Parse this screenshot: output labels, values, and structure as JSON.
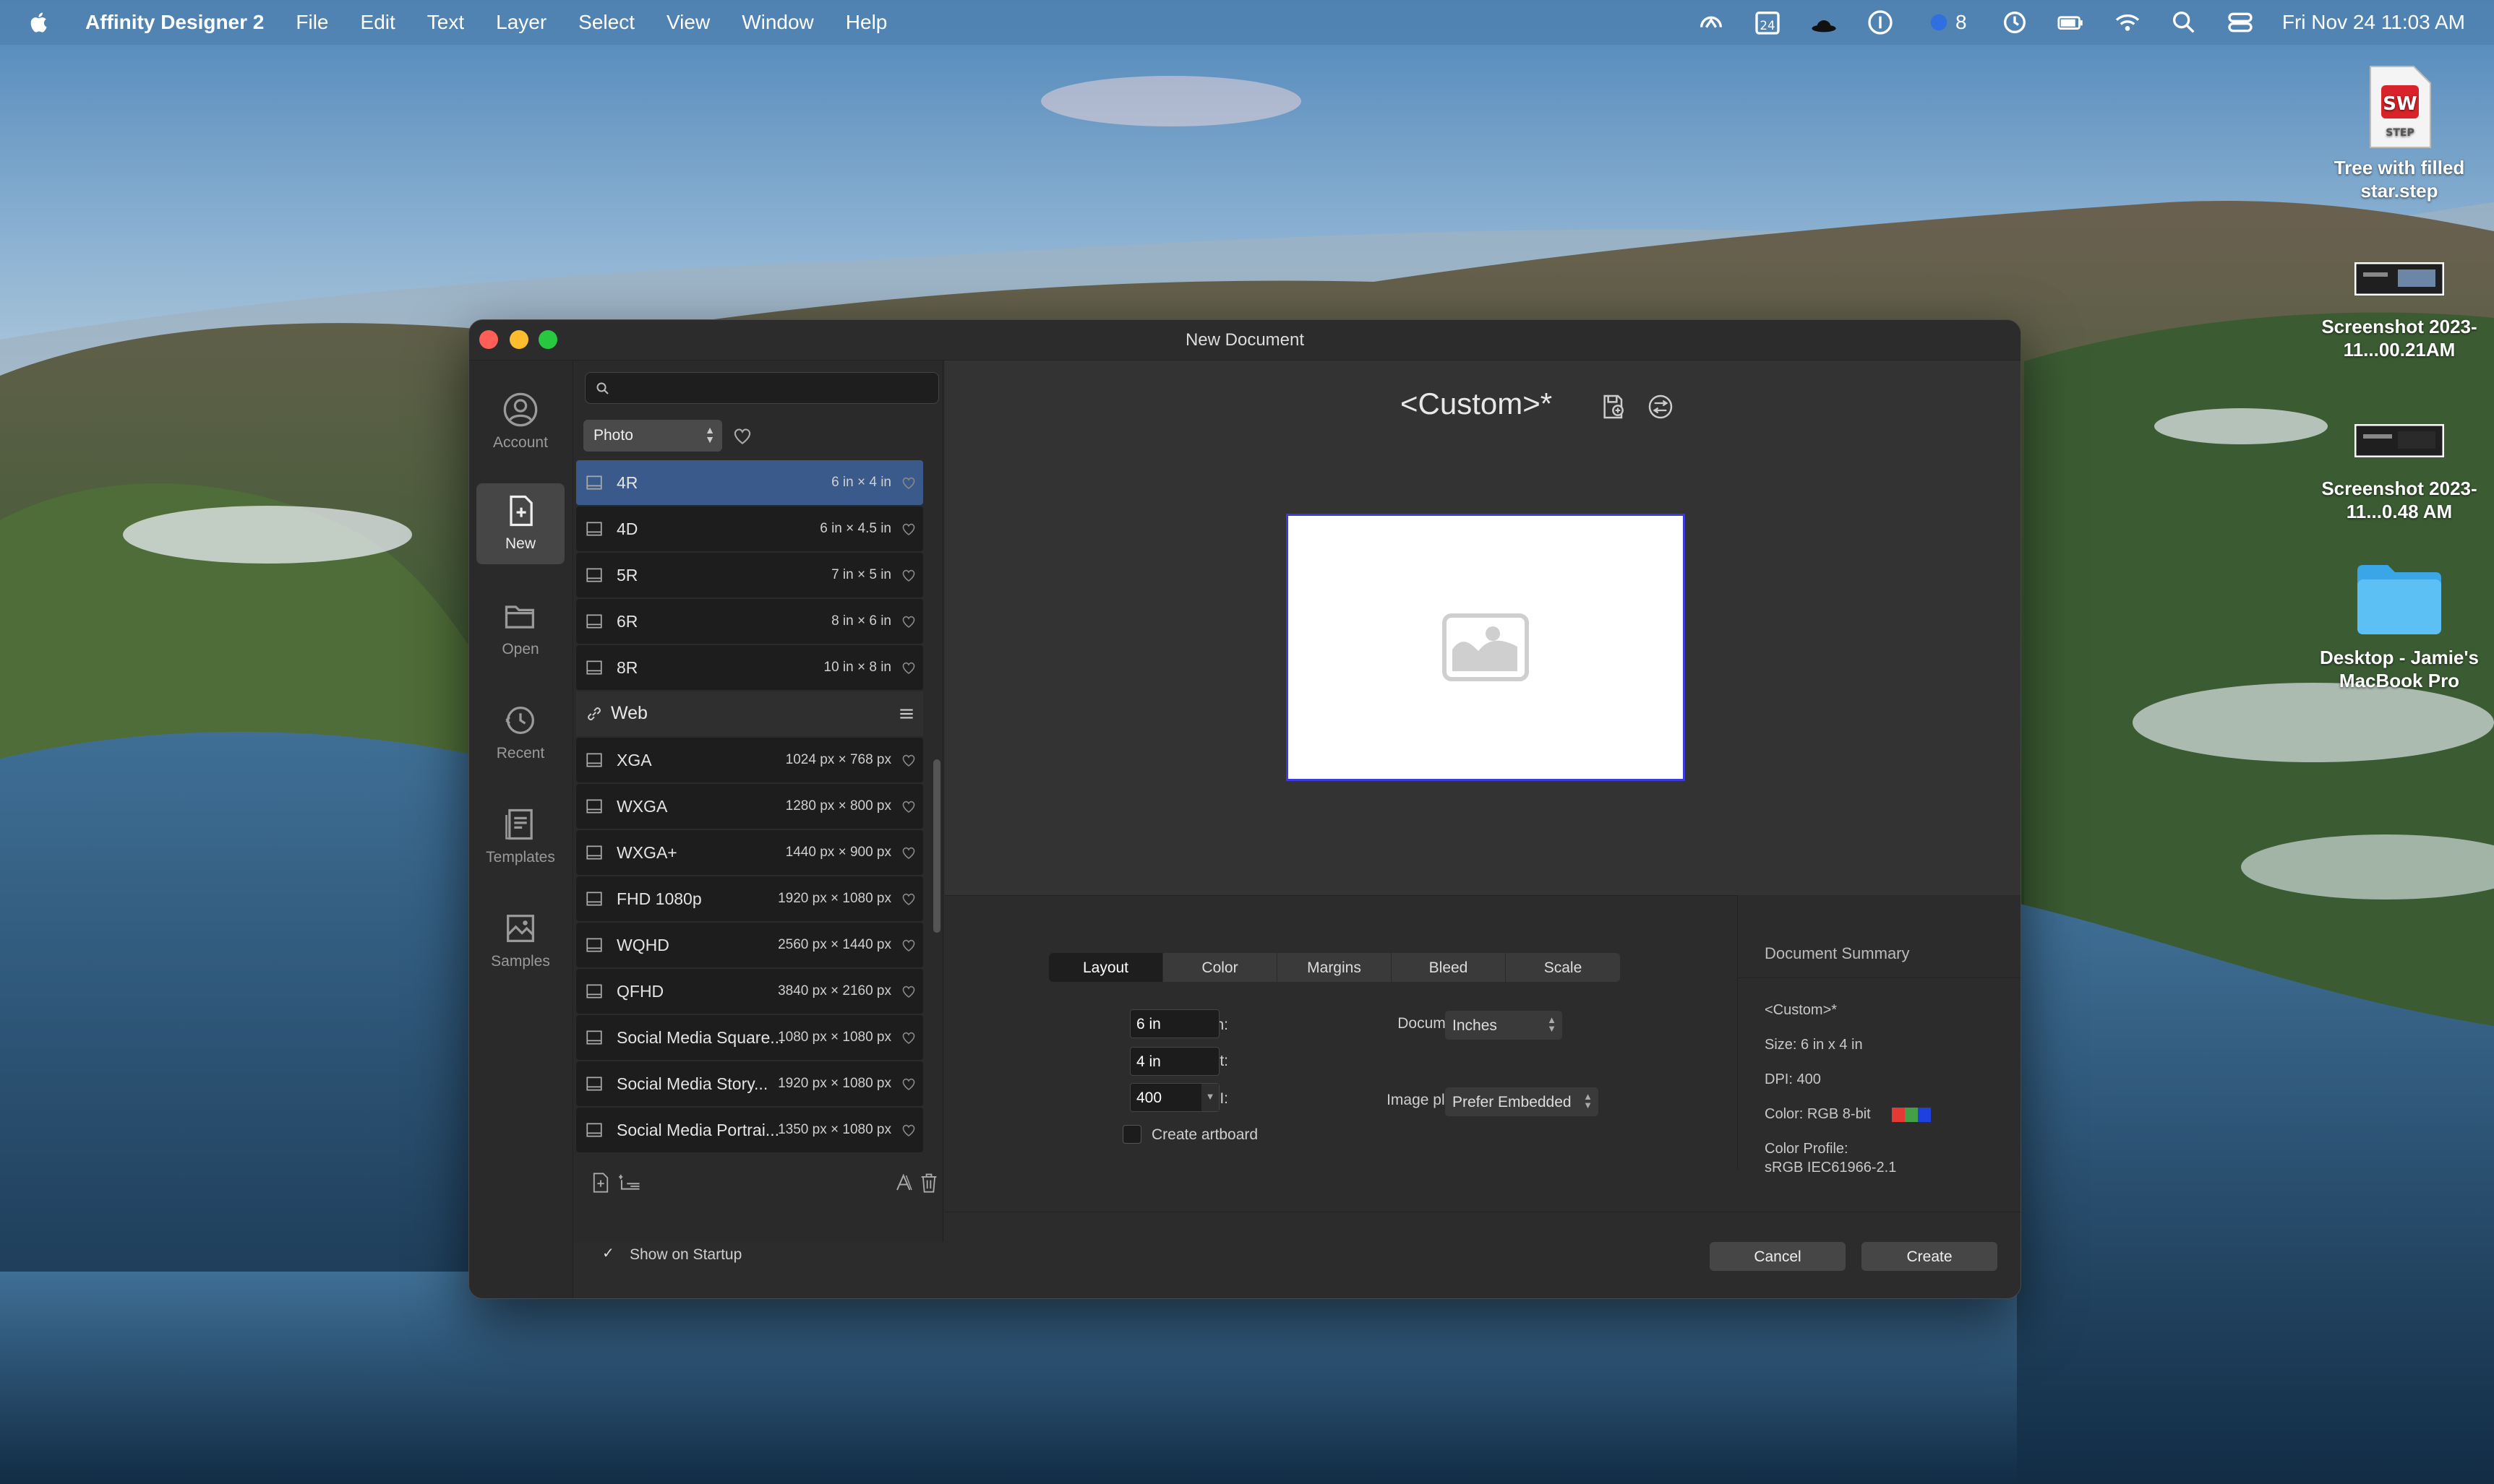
{
  "menubar": {
    "app_name": "Affinity Designer 2",
    "menus": [
      "File",
      "Edit",
      "Text",
      "Layer",
      "Select",
      "View",
      "Window",
      "Help"
    ],
    "calendar_day": "24",
    "notification_count": "8",
    "datetime": "Fri Nov 24  11:03 AM"
  },
  "desktop": {
    "icons": [
      {
        "label": "Tree with filled star.step",
        "badge": "STEP",
        "logo": "SW"
      },
      {
        "label": "Screenshot 2023-11...00.21AM"
      },
      {
        "label": "Screenshot 2023-11...0.48 AM"
      },
      {
        "label": "Desktop - Jamie's MacBook Pro"
      }
    ]
  },
  "dialog": {
    "title": "New Document",
    "sidebar": [
      {
        "label": "Account",
        "icon": "account-icon"
      },
      {
        "label": "New",
        "icon": "new-document-icon"
      },
      {
        "label": "Open",
        "icon": "open-folder-icon"
      },
      {
        "label": "Recent",
        "icon": "recent-clock-icon"
      },
      {
        "label": "Templates",
        "icon": "templates-icon"
      },
      {
        "label": "Samples",
        "icon": "samples-icon"
      }
    ],
    "search": {
      "placeholder": "",
      "value": ""
    },
    "category": "Photo",
    "presets_photo": [
      {
        "name": "4R",
        "size": "6 in × 4 in"
      },
      {
        "name": "4D",
        "size": "6 in × 4.5 in"
      },
      {
        "name": "5R",
        "size": "7 in × 5 in"
      },
      {
        "name": "6R",
        "size": "8 in × 6 in"
      },
      {
        "name": "8R",
        "size": "10 in × 8 in"
      }
    ],
    "web_group_label": "Web",
    "presets_web": [
      {
        "name": "XGA",
        "size": "1024 px × 768 px"
      },
      {
        "name": "WXGA",
        "size": "1280 px × 800 px"
      },
      {
        "name": "WXGA+",
        "size": "1440 px × 900 px"
      },
      {
        "name": "FHD 1080p",
        "size": "1920 px × 1080 px"
      },
      {
        "name": "WQHD",
        "size": "2560 px × 1440 px"
      },
      {
        "name": "QFHD",
        "size": "3840 px × 2160 px"
      },
      {
        "name": "Social Media Square...",
        "size": "1080 px × 1080 px"
      },
      {
        "name": "Social Media Story...",
        "size": "1920 px × 1080 px"
      },
      {
        "name": "Social Media Portrai...",
        "size": "1350 px × 1080 px"
      }
    ],
    "preset_title": "<Custom>*",
    "tabs": [
      "Layout",
      "Color",
      "Margins",
      "Bleed",
      "Scale"
    ],
    "layout": {
      "page_width_label": "Page width:",
      "page_width": "6 in",
      "page_height_label": "Page height:",
      "page_height": "4 in",
      "dpi_label": "DPI:",
      "dpi": "400",
      "create_artboard_label": "Create artboard",
      "document_units_label": "Document units:",
      "document_units": "Inches",
      "image_placement_label": "Image placement:",
      "image_placement": "Prefer Embedded"
    },
    "summary": {
      "heading": "Document Summary",
      "preset": "<Custom>*",
      "size": "Size: 6 in x 4 in",
      "dpi": "DPI:  400",
      "color": "Color: RGB 8-bit",
      "color_profile_label": "Color Profile:",
      "color_profile": "sRGB IEC61966-2.1",
      "swatch_colors": [
        "#e53935",
        "#43a047",
        "#1e40e0"
      ]
    },
    "show_on_startup_label": "Show on Startup",
    "cancel_label": "Cancel",
    "create_label": "Create",
    "colors": {
      "selection": "#3a5a8c",
      "preview_border": "#3a3adf"
    }
  }
}
